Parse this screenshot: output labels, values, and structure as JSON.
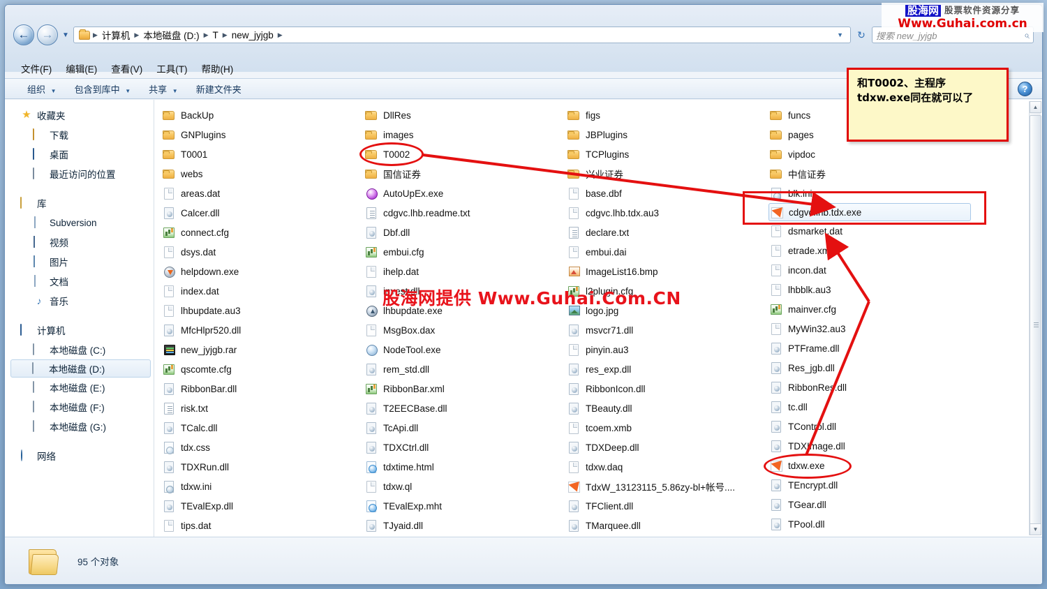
{
  "address": {
    "back_icon": "back-arrow-icon",
    "forward_icon": "forward-arrow-icon",
    "history_icon": "chevron-down-icon",
    "refresh_icon": "refresh-icon",
    "crumbs": [
      "计算机",
      "本地磁盘 (D:)",
      "T",
      "new_jyjgb"
    ],
    "separator": "▶",
    "dropdown_icon": "chevron-down-icon"
  },
  "search": {
    "placeholder": "搜索 new_jyjgb",
    "value": "",
    "icon": "search-icon"
  },
  "menubar": {
    "items": [
      "文件(F)",
      "编辑(E)",
      "查看(V)",
      "工具(T)",
      "帮助(H)"
    ]
  },
  "commandbar": {
    "items": [
      {
        "label": "组织",
        "has_caret": true
      },
      {
        "label": "包含到库中",
        "has_caret": true
      },
      {
        "label": "共享",
        "has_caret": true
      },
      {
        "label": "新建文件夹",
        "has_caret": false
      }
    ],
    "help_label": "?",
    "help_icon": "help-icon"
  },
  "sidebar": {
    "groups": [
      {
        "header": {
          "label": "收藏夹",
          "icon": "star-icon",
          "icon_class": "ic-star",
          "glyph": "★"
        },
        "items": [
          {
            "label": "下载",
            "icon": "downloads-folder-icon",
            "icon_class": "ic-dl"
          },
          {
            "label": "桌面",
            "icon": "desktop-icon",
            "icon_class": "ic-desk"
          },
          {
            "label": "最近访问的位置",
            "icon": "recent-places-icon",
            "icon_class": "ic-recent"
          }
        ]
      },
      {
        "header": {
          "label": "库",
          "icon": "library-icon",
          "icon_class": "ic-lib",
          "glyph": ""
        },
        "items": [
          {
            "label": "Subversion",
            "icon": "subversion-icon",
            "icon_class": "ic-doc2"
          },
          {
            "label": "视频",
            "icon": "videos-icon",
            "icon_class": "ic-vid"
          },
          {
            "label": "图片",
            "icon": "pictures-icon",
            "icon_class": "ic-pic"
          },
          {
            "label": "文档",
            "icon": "documents-icon",
            "icon_class": "ic-doc2"
          },
          {
            "label": "音乐",
            "icon": "music-icon",
            "icon_class": "ic-music",
            "glyph": "♪"
          }
        ]
      },
      {
        "header": {
          "label": "计算机",
          "icon": "computer-icon",
          "icon_class": "ic-pc",
          "glyph": ""
        },
        "items": [
          {
            "label": "本地磁盘 (C:)",
            "icon": "drive-c-icon",
            "icon_class": "ic-drvc",
            "selected": false
          },
          {
            "label": "本地磁盘 (D:)",
            "icon": "drive-d-icon",
            "icon_class": "ic-drv",
            "selected": true
          },
          {
            "label": "本地磁盘 (E:)",
            "icon": "drive-e-icon",
            "icon_class": "ic-drv",
            "selected": false
          },
          {
            "label": "本地磁盘 (F:)",
            "icon": "drive-f-icon",
            "icon_class": "ic-drv",
            "selected": false
          },
          {
            "label": "本地磁盘 (G:)",
            "icon": "drive-g-icon",
            "icon_class": "ic-drv",
            "selected": false
          }
        ]
      },
      {
        "header": {
          "label": "网络",
          "icon": "network-icon",
          "icon_class": "ic-net",
          "glyph": ""
        },
        "items": []
      }
    ]
  },
  "files": {
    "columns": [
      {
        "items": [
          {
            "name": "BackUp",
            "type": "folder",
            "icon_class": "t-folder"
          },
          {
            "name": "GNPlugins",
            "type": "folder",
            "icon_class": "t-folder"
          },
          {
            "name": "T0001",
            "type": "folder",
            "icon_class": "t-folder"
          },
          {
            "name": "webs",
            "type": "folder",
            "icon_class": "t-folder"
          },
          {
            "name": "areas.dat",
            "type": "dat",
            "icon_class": "t-blank"
          },
          {
            "name": "Calcer.dll",
            "type": "dll",
            "icon_class": "t-dll"
          },
          {
            "name": "connect.cfg",
            "type": "cfg",
            "icon_class": "t-cfg"
          },
          {
            "name": "dsys.dat",
            "type": "dat",
            "icon_class": "t-blank"
          },
          {
            "name": "helpdown.exe",
            "type": "exe",
            "icon_class": "t-exe-help"
          },
          {
            "name": "index.dat",
            "type": "dat",
            "icon_class": "t-blank"
          },
          {
            "name": "lhbupdate.au3",
            "type": "au3",
            "icon_class": "t-blank"
          },
          {
            "name": "MfcHlpr520.dll",
            "type": "dll",
            "icon_class": "t-dll"
          },
          {
            "name": "new_jyjgb.rar",
            "type": "rar",
            "icon_class": "t-rar"
          },
          {
            "name": "qscomte.cfg",
            "type": "cfg",
            "icon_class": "t-cfg"
          },
          {
            "name": "RibbonBar.dll",
            "type": "dll",
            "icon_class": "t-dll"
          },
          {
            "name": "risk.txt",
            "type": "txt",
            "icon_class": "t-txt"
          },
          {
            "name": "TCalc.dll",
            "type": "dll",
            "icon_class": "t-dll"
          },
          {
            "name": "tdx.css",
            "type": "css",
            "icon_class": "t-css"
          },
          {
            "name": "TDXRun.dll",
            "type": "dll",
            "icon_class": "t-dll"
          },
          {
            "name": "tdxw.ini",
            "type": "ini",
            "icon_class": "t-ini"
          },
          {
            "name": "TEvalExp.dll",
            "type": "dll",
            "icon_class": "t-dll"
          },
          {
            "name": "tips.dat",
            "type": "dat",
            "icon_class": "t-blank"
          }
        ]
      },
      {
        "items": [
          {
            "name": "DllRes",
            "type": "folder",
            "icon_class": "t-folder"
          },
          {
            "name": "images",
            "type": "folder",
            "icon_class": "t-folder"
          },
          {
            "name": "T0002",
            "type": "folder",
            "icon_class": "t-folder",
            "annotated": "circled"
          },
          {
            "name": "国信证券",
            "type": "folder",
            "icon_class": "t-folder"
          },
          {
            "name": "AutoUpEx.exe",
            "type": "exe",
            "icon_class": "t-exe-purple"
          },
          {
            "name": "cdgvc.lhb.readme.txt",
            "type": "txt",
            "icon_class": "t-txt"
          },
          {
            "name": "Dbf.dll",
            "type": "dll",
            "icon_class": "t-dll"
          },
          {
            "name": "embui.cfg",
            "type": "cfg",
            "icon_class": "t-cfg"
          },
          {
            "name": "ihelp.dat",
            "type": "dat",
            "icon_class": "t-blank"
          },
          {
            "name": "invest.dll",
            "type": "dll",
            "icon_class": "t-dll"
          },
          {
            "name": "lhbupdate.exe",
            "type": "exe",
            "icon_class": "t-exe-lhb"
          },
          {
            "name": "MsgBox.dax",
            "type": "dax",
            "icon_class": "t-blank"
          },
          {
            "name": "NodeTool.exe",
            "type": "exe",
            "icon_class": "t-exe-node"
          },
          {
            "name": "rem_std.dll",
            "type": "dll",
            "icon_class": "t-dll"
          },
          {
            "name": "RibbonBar.xml",
            "type": "xml",
            "icon_class": "t-cfg"
          },
          {
            "name": "T2EECBase.dll",
            "type": "dll",
            "icon_class": "t-dll"
          },
          {
            "name": "TcApi.dll",
            "type": "dll",
            "icon_class": "t-dll"
          },
          {
            "name": "TDXCtrl.dll",
            "type": "dll",
            "icon_class": "t-dll"
          },
          {
            "name": "tdxtime.html",
            "type": "html",
            "icon_class": "t-html"
          },
          {
            "name": "tdxw.ql",
            "type": "ql",
            "icon_class": "t-blank"
          },
          {
            "name": "TEvalExp.mht",
            "type": "mht",
            "icon_class": "t-html"
          },
          {
            "name": "TJyaid.dll",
            "type": "dll",
            "icon_class": "t-dll"
          }
        ]
      },
      {
        "items": [
          {
            "name": "figs",
            "type": "folder",
            "icon_class": "t-folder"
          },
          {
            "name": "JBPlugins",
            "type": "folder",
            "icon_class": "t-folder"
          },
          {
            "name": "TCPlugins",
            "type": "folder",
            "icon_class": "t-folder"
          },
          {
            "name": "兴业证券",
            "type": "folder",
            "icon_class": "t-folder"
          },
          {
            "name": "base.dbf",
            "type": "dbf",
            "icon_class": "t-blank"
          },
          {
            "name": "cdgvc.lhb.tdx.au3",
            "type": "au3",
            "icon_class": "t-blank"
          },
          {
            "name": "declare.txt",
            "type": "txt",
            "icon_class": "t-txt"
          },
          {
            "name": "embui.dai",
            "type": "dai",
            "icon_class": "t-blank"
          },
          {
            "name": "ImageList16.bmp",
            "type": "bmp",
            "icon_class": "t-bmp"
          },
          {
            "name": "l2plugin.cfg",
            "type": "cfg",
            "icon_class": "t-cfg"
          },
          {
            "name": "logo.jpg",
            "type": "jpg",
            "icon_class": "t-jpg"
          },
          {
            "name": "msvcr71.dll",
            "type": "dll",
            "icon_class": "t-dll"
          },
          {
            "name": "pinyin.au3",
            "type": "au3",
            "icon_class": "t-blank"
          },
          {
            "name": "res_exp.dll",
            "type": "dll",
            "icon_class": "t-dll"
          },
          {
            "name": "RibbonIcon.dll",
            "type": "dll",
            "icon_class": "t-dll"
          },
          {
            "name": "TBeauty.dll",
            "type": "dll",
            "icon_class": "t-dll"
          },
          {
            "name": "tcoem.xmb",
            "type": "xmb",
            "icon_class": "t-blank"
          },
          {
            "name": "TDXDeep.dll",
            "type": "dll",
            "icon_class": "t-dll"
          },
          {
            "name": "tdxw.daq",
            "type": "daq",
            "icon_class": "t-blank"
          },
          {
            "name": "TdxW_13123115_5.86zy-bl+帐号....",
            "type": "exe",
            "icon_class": "t-exe-orange"
          },
          {
            "name": "TFClient.dll",
            "type": "dll",
            "icon_class": "t-dll"
          },
          {
            "name": "TMarquee.dll",
            "type": "dll",
            "icon_class": "t-dll"
          }
        ]
      },
      {
        "items": [
          {
            "name": "funcs",
            "type": "folder",
            "icon_class": "t-folder"
          },
          {
            "name": "pages",
            "type": "folder",
            "icon_class": "t-folder"
          },
          {
            "name": "vipdoc",
            "type": "folder",
            "icon_class": "t-folder"
          },
          {
            "name": "中信证券",
            "type": "folder",
            "icon_class": "t-folder"
          },
          {
            "name": "blk.ini",
            "type": "ini",
            "icon_class": "t-ini"
          },
          {
            "name": "cdgvc.lhb.tdx.exe",
            "type": "exe",
            "icon_class": "t-exe-orange",
            "selected": true,
            "annotated": "boxed"
          },
          {
            "name": "dsmarket.dat",
            "type": "dat",
            "icon_class": "t-blank"
          },
          {
            "name": "etrade.xmb",
            "type": "xmb",
            "icon_class": "t-blank"
          },
          {
            "name": "incon.dat",
            "type": "dat",
            "icon_class": "t-blank"
          },
          {
            "name": "lhbblk.au3",
            "type": "au3",
            "icon_class": "t-blank"
          },
          {
            "name": "mainver.cfg",
            "type": "cfg",
            "icon_class": "t-cfg"
          },
          {
            "name": "MyWin32.au3",
            "type": "au3",
            "icon_class": "t-blank"
          },
          {
            "name": "PTFrame.dll",
            "type": "dll",
            "icon_class": "t-dll"
          },
          {
            "name": "Res_jgb.dll",
            "type": "dll",
            "icon_class": "t-dll"
          },
          {
            "name": "RibbonRes.dll",
            "type": "dll",
            "icon_class": "t-dll"
          },
          {
            "name": "tc.dll",
            "type": "dll",
            "icon_class": "t-dll"
          },
          {
            "name": "TControl.dll",
            "type": "dll",
            "icon_class": "t-dll"
          },
          {
            "name": "TDXImage.dll",
            "type": "dll",
            "icon_class": "t-dll"
          },
          {
            "name": "tdxw.exe",
            "type": "exe",
            "icon_class": "t-exe-orange",
            "annotated": "circled"
          },
          {
            "name": "TEncrypt.dll",
            "type": "dll",
            "icon_class": "t-dll"
          },
          {
            "name": "TGear.dll",
            "type": "dll",
            "icon_class": "t-dll"
          },
          {
            "name": "TPool.dll",
            "type": "dll",
            "icon_class": "t-dll"
          }
        ]
      }
    ]
  },
  "scrollbar": {
    "up_icon": "scroll-up-icon",
    "down_icon": "scroll-down-icon",
    "thumb_icon": "scroll-thumb-grip"
  },
  "statusbar": {
    "folder_icon": "folder-icon",
    "text": "95 个对象"
  },
  "annotation": {
    "tooltip_text": "和T0002、主程序tdxw.exe同在就可以了",
    "color": "#e41010",
    "tooltip_bg": "#fdf8c8",
    "tooltip_border": "#e00000"
  },
  "watermark": {
    "badge": "股海网",
    "subtitle": "股票软件资源分享",
    "url": "Www.Guhai.com.cn",
    "center_text": "股海网提供 Www.Guhai.Com.CN",
    "badge_color": "#1414c8",
    "url_color": "#e00000"
  }
}
